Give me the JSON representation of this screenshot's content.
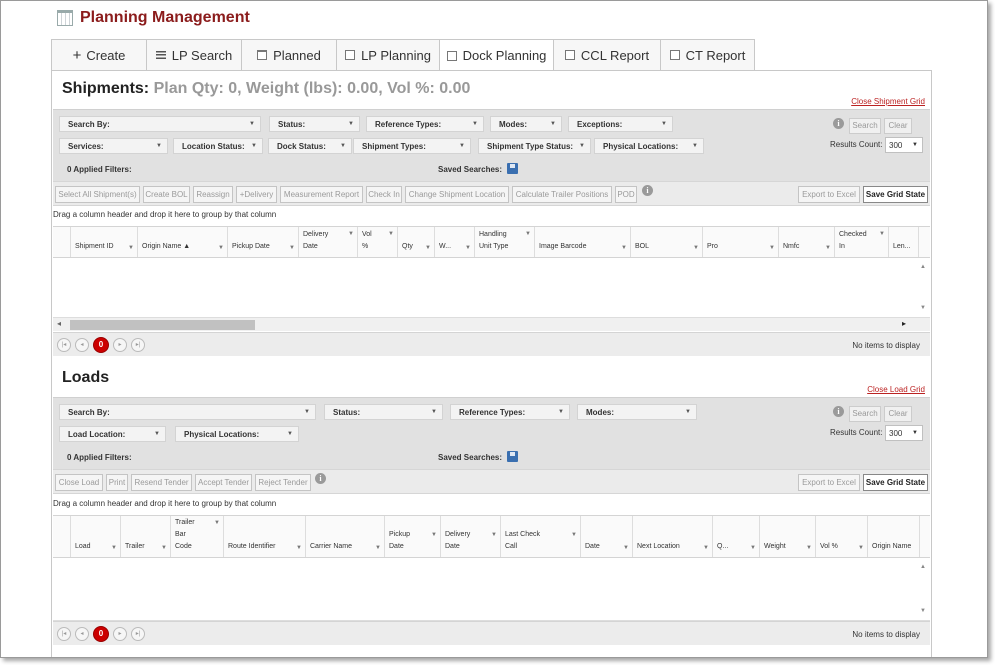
{
  "header": {
    "title": "Planning Management"
  },
  "tabs": [
    {
      "label": "Create",
      "icon": "plus-icon"
    },
    {
      "label": "LP Search",
      "icon": "list-icon"
    },
    {
      "label": "Planned",
      "icon": "calendar-icon"
    },
    {
      "label": "LP Planning",
      "icon": "square-icon"
    },
    {
      "label": "Dock Planning",
      "icon": "square-icon",
      "active": true
    },
    {
      "label": "CCL Report",
      "icon": "square-icon"
    },
    {
      "label": "CT Report",
      "icon": "square-icon"
    }
  ],
  "shipments": {
    "title": "Shipments:",
    "summary": "Plan Qty: 0, Weight (lbs): 0.00, Vol %: 0.00",
    "close_link": "Close Shipment Grid",
    "filters": {
      "search_by": "Search By:",
      "status": "Status:",
      "reference_types": "Reference Types:",
      "modes": "Modes:",
      "exceptions": "Exceptions:",
      "services": "Services:",
      "location_status": "Location Status:",
      "dock_status": "Dock Status:",
      "shipment_types": "Shipment Types:",
      "shipment_type_status": "Shipment Type Status:",
      "physical_locations": "Physical Locations:",
      "applied": "0 Applied Filters:",
      "saved_searches": "Saved Searches:",
      "search_btn": "Search",
      "clear_btn": "Clear",
      "results_count_label": "Results Count:",
      "results_count": "300"
    },
    "toolbar": [
      "Select All Shipment(s)",
      "Create BOL",
      "Reassign",
      "+Delivery",
      "Measurement Report",
      "Check In",
      "Change Shipment Location",
      "Calculate Trailer Positions",
      "POD"
    ],
    "export": "Export to Excel",
    "save_grid": "Save Grid State",
    "group_hint": "Drag a column header and drop it here to group by that column",
    "columns": [
      "",
      "Shipment ID",
      "Origin Name ▲",
      "Pickup Date",
      "Delivery\nDate",
      "Vol\n%",
      "Qty",
      "W...",
      "Handling\nUnit Type",
      "Image Barcode",
      "BOL",
      "Pro",
      "Nmfc",
      "Checked\nIn",
      "Len..."
    ],
    "page": "0",
    "no_items": "No items to display"
  },
  "loads": {
    "title": "Loads",
    "close_link": "Close Load Grid",
    "filters": {
      "search_by": "Search By:",
      "status": "Status:",
      "reference_types": "Reference Types:",
      "modes": "Modes:",
      "load_location": "Load Location:",
      "physical_locations": "Physical Locations:",
      "applied": "0 Applied Filters:",
      "saved_searches": "Saved Searches:",
      "search_btn": "Search",
      "clear_btn": "Clear",
      "results_count_label": "Results Count:",
      "results_count": "300"
    },
    "toolbar": [
      "Close Load",
      "Print",
      "Resend Tender",
      "Accept Tender",
      "Reject Tender"
    ],
    "export": "Export to Excel",
    "save_grid": "Save Grid State",
    "group_hint": "Drag a column header and drop it here to group by that column",
    "columns": [
      "",
      "Load",
      "Trailer",
      "Trailer\nBar\nCode",
      "Route Identifier",
      "Carrier Name",
      "Pickup\nDate",
      "Delivery\nDate",
      "Last Check\nCall",
      "Date",
      "Next Location",
      "Q...",
      "Weight",
      "Vol %",
      "Origin Name"
    ],
    "page": "0",
    "no_items": "No items to display"
  }
}
